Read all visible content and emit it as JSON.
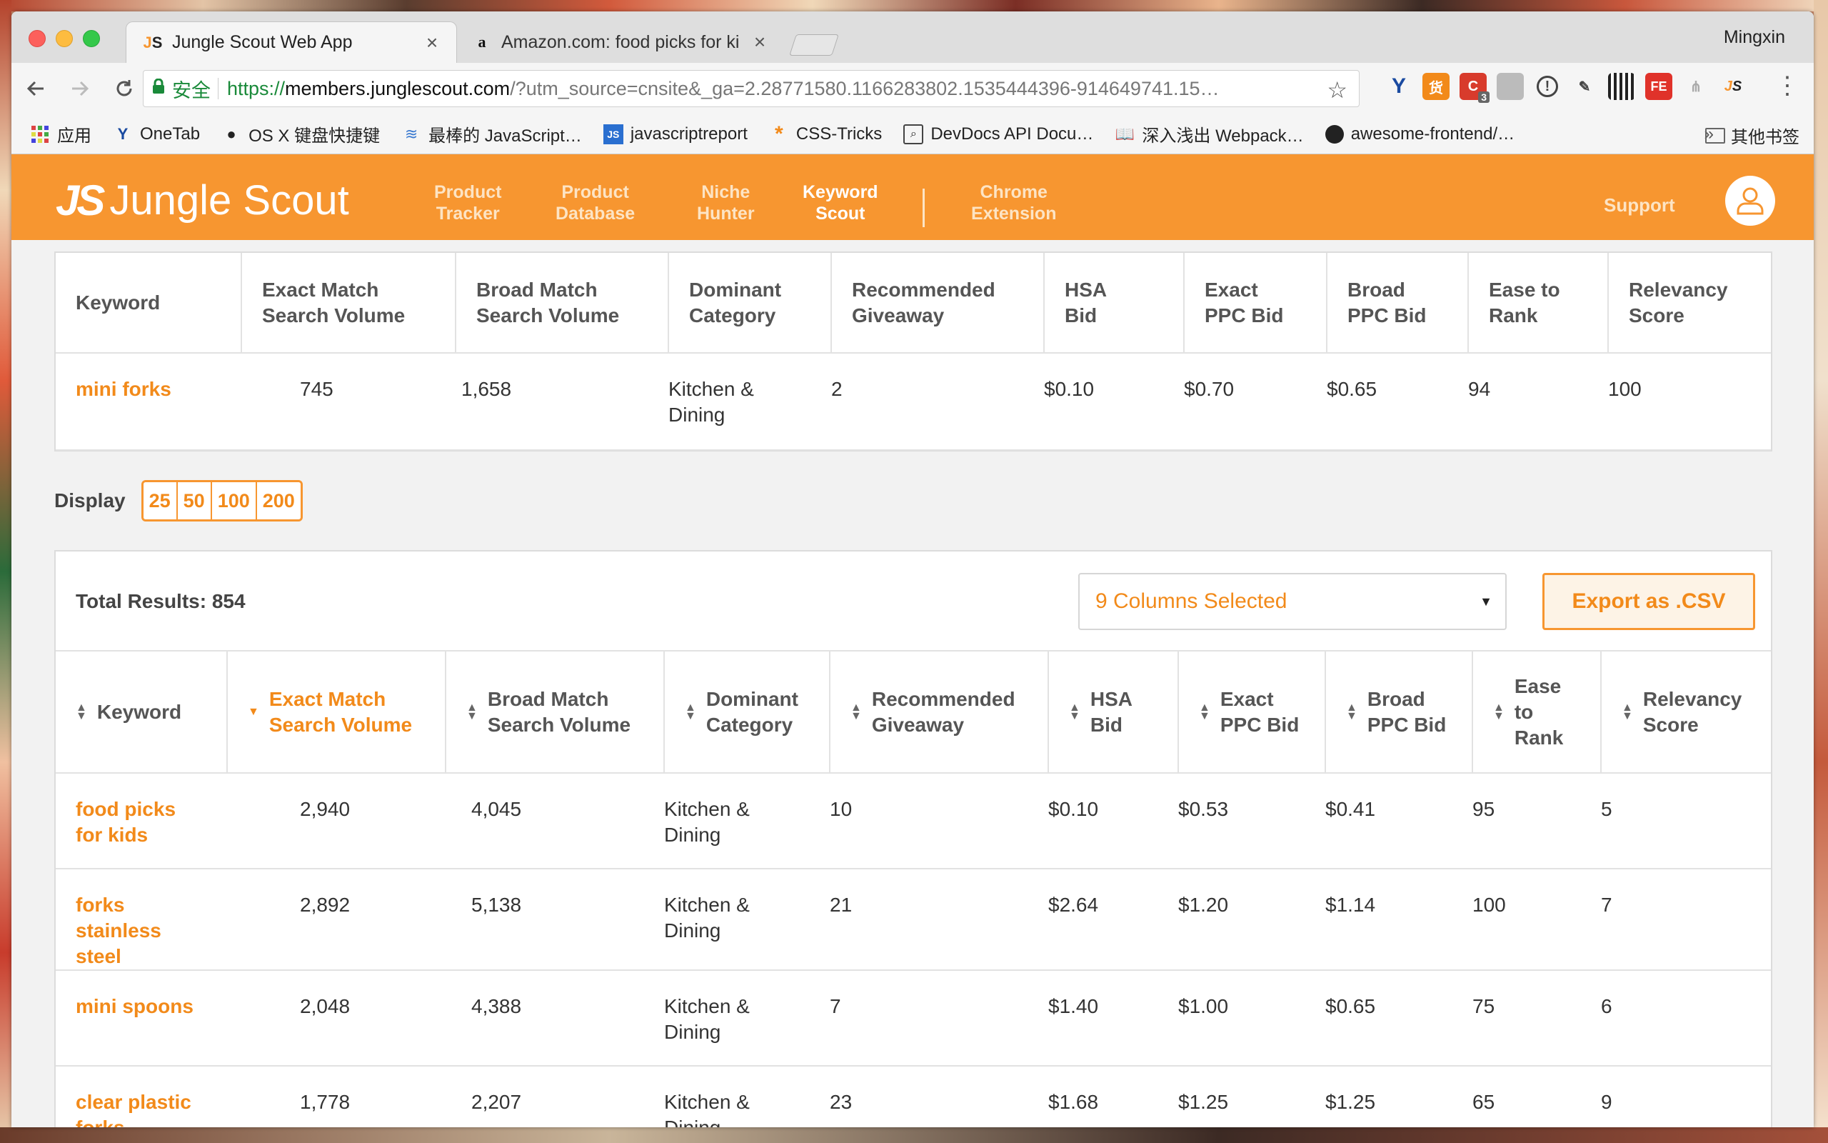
{
  "browser": {
    "tabs": [
      {
        "title": "Jungle Scout Web App",
        "favicon": "JS"
      },
      {
        "title": "Amazon.com: food picks for ki",
        "favicon": "a"
      }
    ],
    "profile": "Mingxin",
    "secure_label": "安全",
    "url_scheme": "https://",
    "url_host": "members.junglescout.com",
    "url_rest": "/?utm_source=cnsite&_ga=2.28771580.1166283802.1535444396-914649741.15…",
    "ext_badge": "3",
    "bookmarks": [
      {
        "label": "应用",
        "icon": "apps-grid-icon"
      },
      {
        "label": "OneTab",
        "icon": "onetab-icon"
      },
      {
        "label": "OS X 键盘快捷键",
        "icon": "apple-icon"
      },
      {
        "label": "最棒的 JavaScript…",
        "icon": "stack-icon"
      },
      {
        "label": "javascriptreport",
        "icon": "js-icon"
      },
      {
        "label": "CSS-Tricks",
        "icon": "asterisk-icon"
      },
      {
        "label": "DevDocs API Docu…",
        "icon": "devdocs-icon"
      },
      {
        "label": "深入浅出 Webpack…",
        "icon": "book-icon"
      },
      {
        "label": "awesome-frontend/…",
        "icon": "github-icon"
      }
    ],
    "bookmarks_more": "»",
    "bookmarks_other": "其他书签"
  },
  "app": {
    "brand": "Jungle Scout",
    "brand_mark": "JS",
    "nav": [
      {
        "line1": "Product",
        "line2": "Tracker",
        "active": false
      },
      {
        "line1": "Product",
        "line2": "Database",
        "active": false
      },
      {
        "line1": "Niche",
        "line2": "Hunter",
        "active": false
      },
      {
        "line1": "Keyword",
        "line2": "Scout",
        "active": true
      },
      {
        "line1": "Chrome",
        "line2": "Extension",
        "active": false
      }
    ],
    "support": "Support",
    "accent_color": "#f79630"
  },
  "top_table": {
    "headers": [
      "Keyword",
      "Exact Match Search Volume",
      "Broad Match Search Volume",
      "Dominant Category",
      "Recommended Giveaway",
      "HSA Bid",
      "Exact PPC Bid",
      "Broad PPC Bid",
      "Ease to Rank",
      "Relevancy Score"
    ],
    "header_lines": [
      [
        "Keyword"
      ],
      [
        "Exact Match",
        "Search Volume"
      ],
      [
        "Broad Match",
        "Search Volume"
      ],
      [
        "Dominant",
        "Category"
      ],
      [
        "Recommended",
        "Giveaway"
      ],
      [
        "HSA",
        "Bid"
      ],
      [
        "Exact",
        "PPC Bid"
      ],
      [
        "Broad",
        "PPC Bid"
      ],
      [
        "Ease to",
        "Rank"
      ],
      [
        "Relevancy",
        "Score"
      ]
    ],
    "row": {
      "keyword": "mini forks",
      "exact": "745",
      "broad": "1,658",
      "category": "Kitchen & Dining",
      "giveaway": "2",
      "hsa": "$0.10",
      "exact_ppc": "$0.70",
      "broad_ppc": "$0.65",
      "ease": "94",
      "relevancy": "100"
    }
  },
  "display": {
    "label": "Display",
    "options": [
      "25",
      "50",
      "100",
      "200"
    ]
  },
  "results": {
    "total_label": "Total Results: 854",
    "columns_selected": "9 Columns Selected",
    "export_label": "Export as .CSV",
    "header_lines": [
      [
        "Keyword"
      ],
      [
        "Exact Match",
        "Search Volume"
      ],
      [
        "Broad Match",
        "Search Volume"
      ],
      [
        "Dominant",
        "Category"
      ],
      [
        "Recommended",
        "Giveaway"
      ],
      [
        "HSA",
        "Bid"
      ],
      [
        "Exact",
        "PPC Bid"
      ],
      [
        "Broad",
        "PPC Bid"
      ],
      [
        "Ease",
        "to",
        "Rank"
      ],
      [
        "Relevancy",
        "Score"
      ]
    ],
    "sorted_column": 1,
    "rows": [
      {
        "keyword": "food picks for kids",
        "exact": "2,940",
        "broad": "4,045",
        "category": "Kitchen & Dining",
        "giveaway": "10",
        "hsa": "$0.10",
        "exact_ppc": "$0.53",
        "broad_ppc": "$0.41",
        "ease": "95",
        "relevancy": "5"
      },
      {
        "keyword": "forks stainless steel",
        "exact": "2,892",
        "broad": "5,138",
        "category": "Kitchen & Dining",
        "giveaway": "21",
        "hsa": "$2.64",
        "exact_ppc": "$1.20",
        "broad_ppc": "$1.14",
        "ease": "100",
        "relevancy": "7"
      },
      {
        "keyword": "mini spoons",
        "exact": "2,048",
        "broad": "4,388",
        "category": "Kitchen & Dining",
        "giveaway": "7",
        "hsa": "$1.40",
        "exact_ppc": "$1.00",
        "broad_ppc": "$0.65",
        "ease": "75",
        "relevancy": "6"
      },
      {
        "keyword": "clear plastic forks",
        "exact": "1,778",
        "broad": "2,207",
        "category": "Kitchen & Dining",
        "giveaway": "23",
        "hsa": "$1.68",
        "exact_ppc": "$1.25",
        "broad_ppc": "$1.25",
        "ease": "65",
        "relevancy": "9"
      }
    ]
  }
}
